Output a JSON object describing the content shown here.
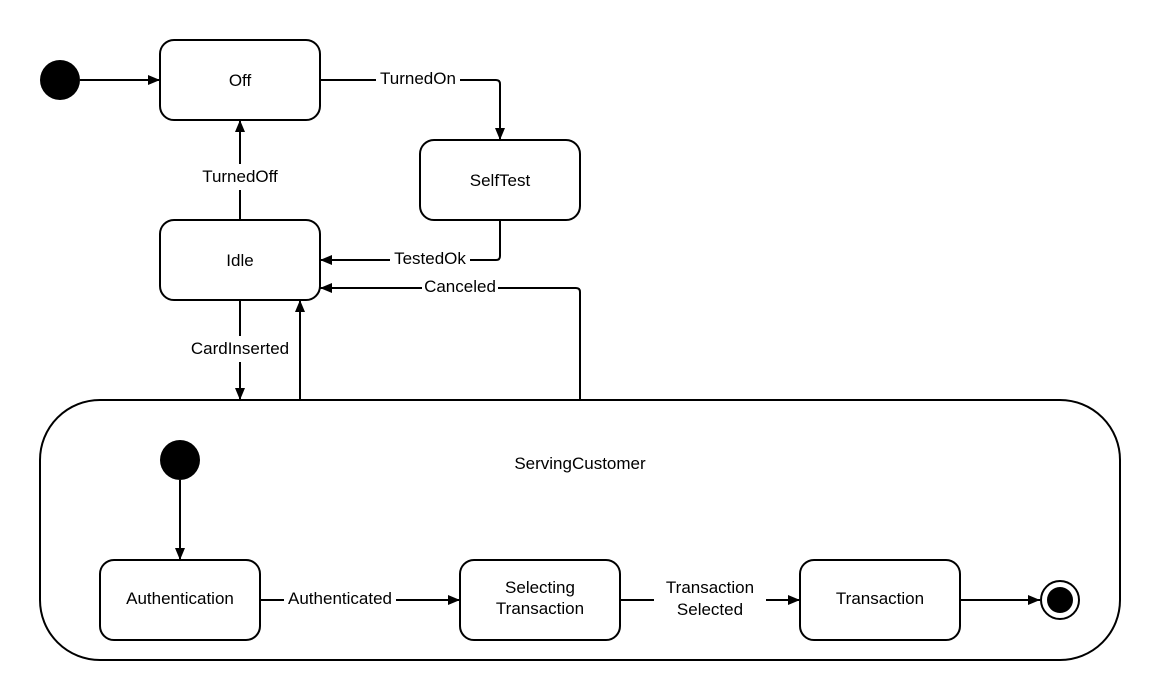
{
  "diagram": {
    "type": "UML state machine",
    "states": {
      "off": "Off",
      "selftest": "SelfTest",
      "idle": "Idle",
      "serving": "ServingCustomer",
      "authentication": "Authentication",
      "selecting_l1": "Selecting",
      "selecting_l2": "Transaction",
      "transaction": "Transaction"
    },
    "transitions": {
      "turned_on": "TurnedOn",
      "turned_off": "TurnedOff",
      "tested_ok": "TestedOk",
      "canceled": "Canceled",
      "card_inserted": "CardInserted",
      "authenticated": "Authenticated",
      "transaction_selected_l1": "Transaction",
      "transaction_selected_l2": "Selected"
    },
    "colors": {
      "stroke": "#000000",
      "fill": "#ffffff"
    }
  }
}
